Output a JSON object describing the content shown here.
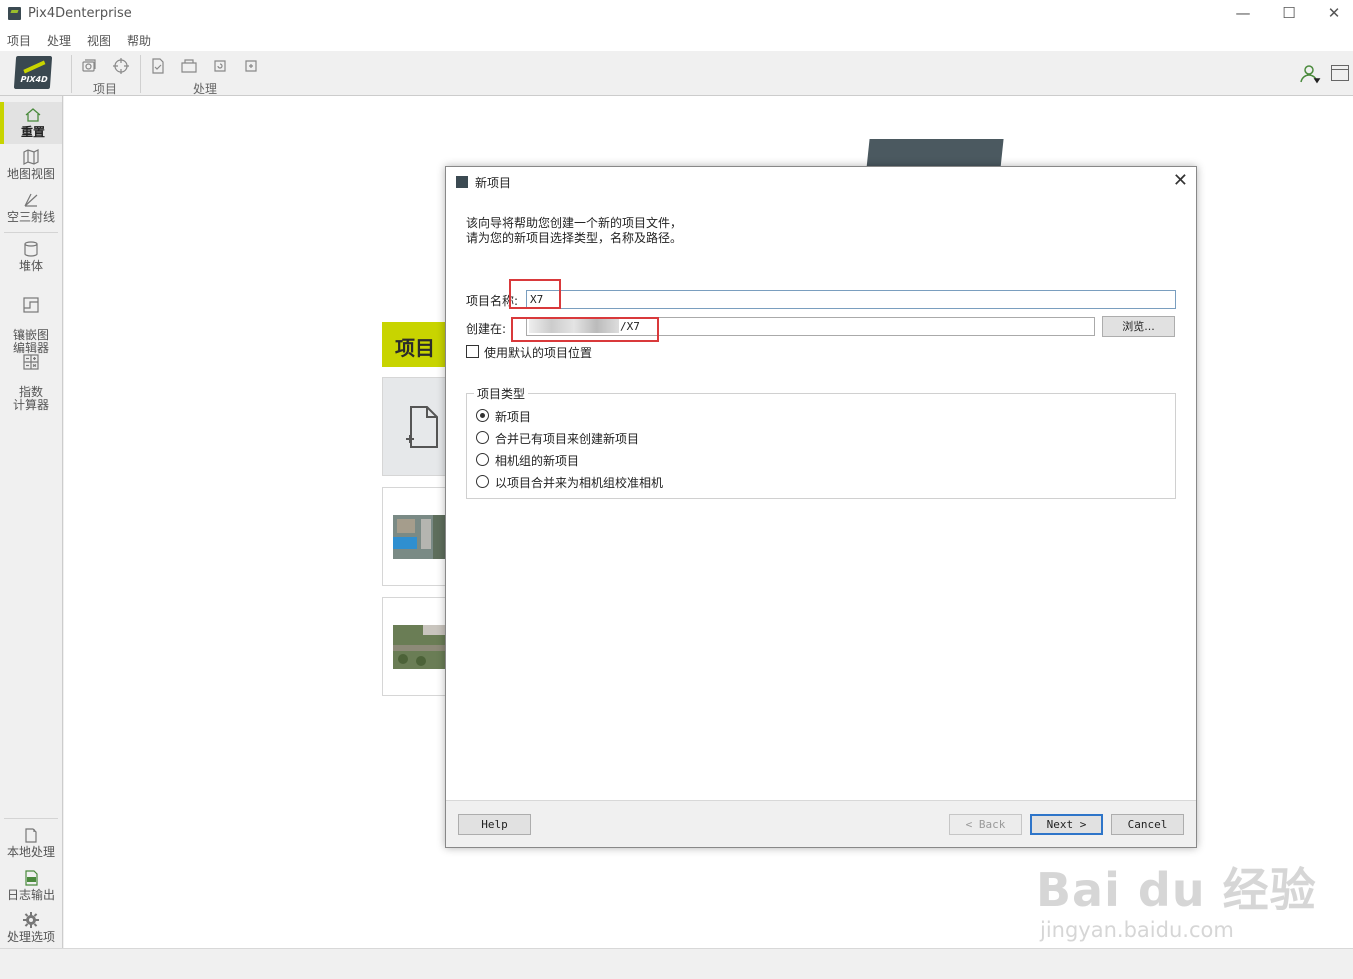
{
  "app": {
    "title": "Pix4Denterprise"
  },
  "window_controls": {
    "minimize": "—",
    "maximize": "☐",
    "close": "✕"
  },
  "menu": [
    "项目",
    "处理",
    "视图",
    "帮助"
  ],
  "toolbar": {
    "logo_text": "PIX4D",
    "project_group_label": "项目",
    "process_group_label": "处理",
    "icons": [
      "images-icon",
      "gcp-icon",
      "check-icon",
      "open-folder-icon",
      "reload-icon",
      "reprocess-icon"
    ]
  },
  "sidebar": {
    "items": [
      {
        "label": "重置",
        "icon": "home-icon",
        "active": true
      },
      {
        "label": "地图视图",
        "icon": "map-icon"
      },
      {
        "label": "空三射线",
        "icon": "rays-icon"
      },
      {
        "label": "堆体",
        "icon": "volume-icon"
      },
      {
        "label": "镶嵌图\n编辑器",
        "icon": "mosaic-icon"
      },
      {
        "label": "指数\n计算器",
        "icon": "calculator-icon"
      }
    ],
    "bottom_items": [
      {
        "label": "本地处理",
        "icon": "local-process-icon"
      },
      {
        "label": "日志输出",
        "icon": "log-icon"
      },
      {
        "label": "处理选项",
        "icon": "gear-icon"
      }
    ]
  },
  "background": {
    "project_label": "项目"
  },
  "dialog": {
    "title": "新项目",
    "intro_line1": "该向导将帮助您创建一个新的项目文件，",
    "intro_line2": "请为您的新项目选择类型，名称及路径。",
    "name_label": "项目名称:",
    "name_value": "X7",
    "location_label": "创建在:",
    "location_value": "/X7",
    "browse_label": "浏览...",
    "default_location_label": "使用默认的项目位置",
    "default_location_checked": false,
    "project_type_title": "项目类型",
    "project_types": [
      {
        "label": "新项目",
        "checked": true
      },
      {
        "label": "合并已有项目来创建新项目",
        "checked": false
      },
      {
        "label": "相机组的新项目",
        "checked": false
      },
      {
        "label": "以项目合并来为相机组校准相机",
        "checked": false
      }
    ],
    "buttons": {
      "help": "Help",
      "back": "< Back",
      "next": "Next >",
      "cancel": "Cancel"
    }
  },
  "watermark": {
    "brand": "Bai du 经验",
    "url": "jingyan.baidu.com"
  },
  "colors": {
    "accent": "#c8d400",
    "highlight": "#d9393b",
    "primary_button_border": "#2e75c9"
  }
}
